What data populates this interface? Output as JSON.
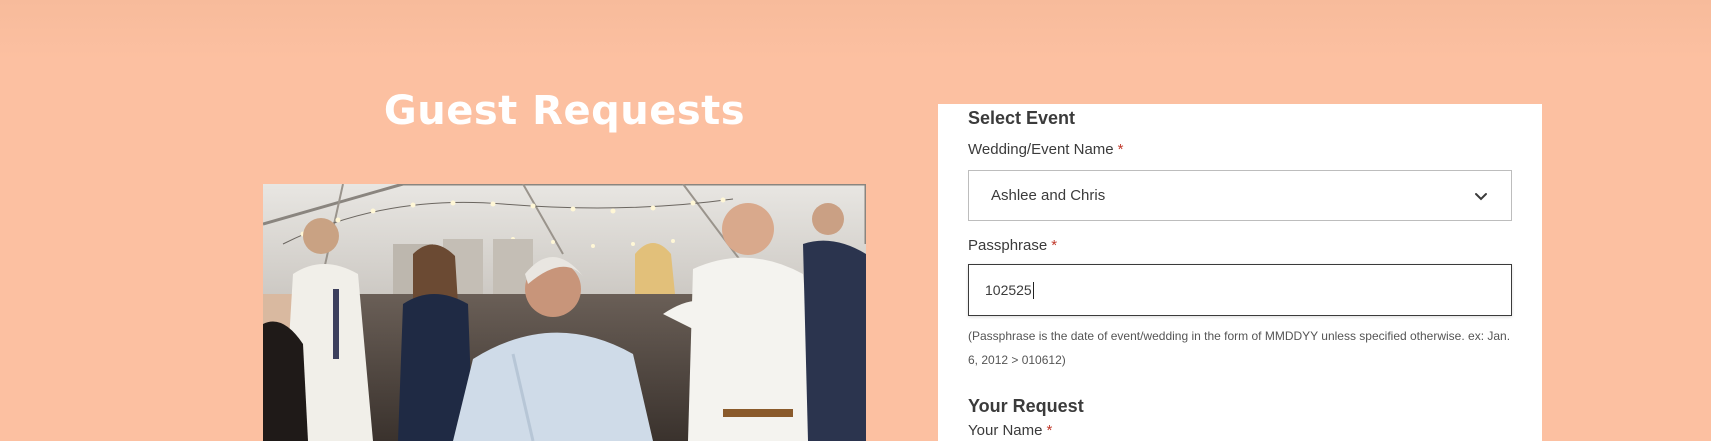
{
  "header": {
    "title": "Guest Requests"
  },
  "photo": {
    "description_icon": "party-photo"
  },
  "form": {
    "select_event": {
      "heading": "Select Event",
      "event_label": "Wedding/Event Name",
      "required_mark": "*",
      "event_value": "Ashlee and Chris"
    },
    "passphrase": {
      "label": "Passphrase",
      "required_mark": "*",
      "value": "102525",
      "help": "(Passphrase is the date of event/wedding in the form of MMDDYY unless specified otherwise. ex: Jan. 6, 2012 > 010612)"
    },
    "your_request": {
      "heading": "Your Request",
      "name_label": "Your Name",
      "required_mark": "*"
    }
  },
  "colors": {
    "background": "#fcc0a1",
    "card": "#ffffff",
    "required": "#c0392b",
    "text": "#3b3b3b"
  }
}
